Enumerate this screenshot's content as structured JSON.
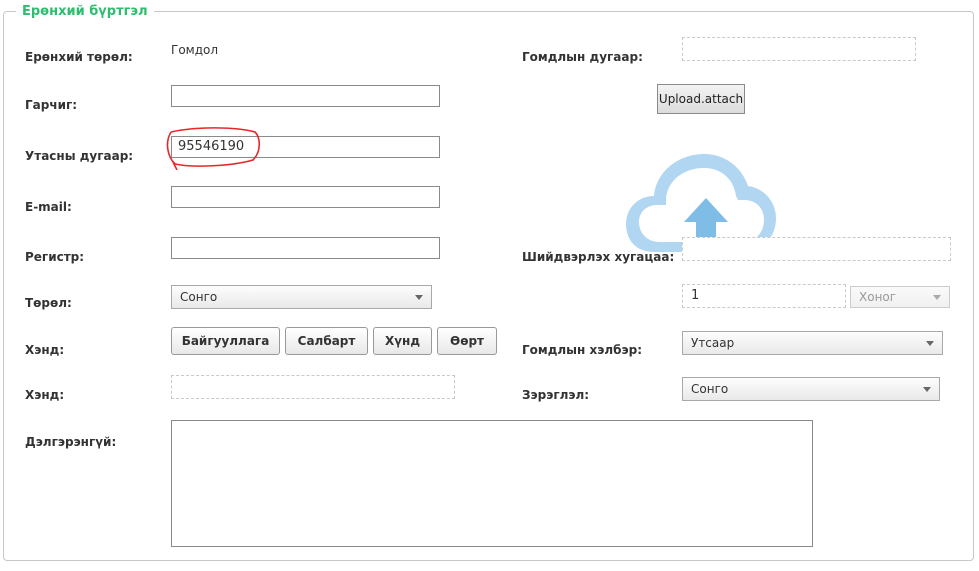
{
  "section": {
    "title": "Ерөнхий бүртгэл"
  },
  "form": {
    "general_type_label": "Ерөнхий төрөл:",
    "general_type_value": "Гомдол",
    "subject_label": "Гарчиг:",
    "subject_value": "",
    "phone_label": "Утасны дугаар:",
    "phone_value": "95546190",
    "email_label": "E-mail:",
    "email_value": "",
    "register_label": "Регистр:",
    "register_value": "",
    "type_label": "Төрөл:",
    "type_value": "Сонго",
    "to_whom_label": "Хэнд:",
    "to_whom_buttons": [
      "Байгууллага",
      "Салбарт",
      "Хүнд",
      "Өөрт"
    ],
    "to_whom2_label": "Хэнд:",
    "details_label": "Дэлгэрэнгүй:",
    "complaint_number_label": "Гомдлын дугаар:",
    "upload_label": "Upload.attach",
    "deadline_label": "Шийдвэрлэх хугацаа:",
    "deadline_value": "1",
    "deadline_unit": "Хоног",
    "complaint_form_label": "Гомдлын хэлбэр:",
    "complaint_form_value": "Утсаар",
    "severity_label": "Зэрэглэл:",
    "severity_value": "Сонго"
  },
  "colors": {
    "legend": "#2dbd6e",
    "annotation": "#e8262a",
    "cloud": "#7fbde6"
  },
  "icons": {
    "upload": "cloud-upload-icon"
  }
}
